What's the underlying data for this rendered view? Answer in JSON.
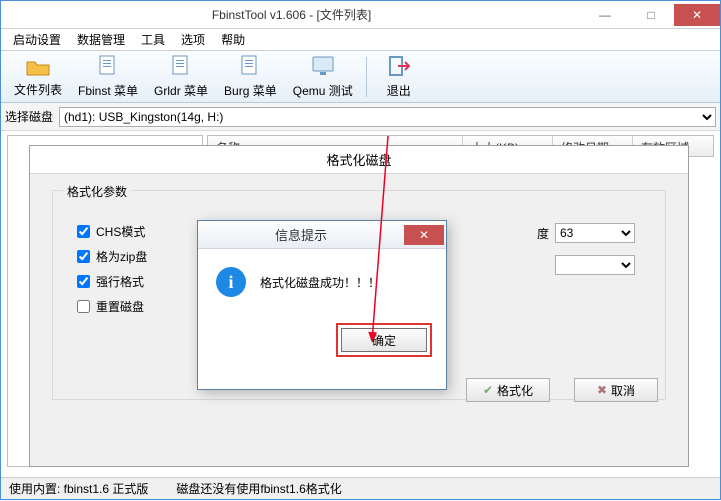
{
  "window": {
    "title": "FbinstTool v1.606 - [文件列表]"
  },
  "menu": {
    "items": [
      "启动设置",
      "数据管理",
      "工具",
      "选项",
      "帮助"
    ]
  },
  "toolbar": {
    "items": [
      "文件列表",
      "Fbinst 菜单",
      "Grldr 菜单",
      "Burg 菜单",
      "Qemu 测试",
      "退出"
    ]
  },
  "diskrow": {
    "label": "选择磁盘",
    "value": "(hd1): USB_Kingston(14g, H:)"
  },
  "table": {
    "cols": [
      "名称",
      "大小(KB)",
      "修改日期",
      "存放区域"
    ]
  },
  "format_dialog": {
    "title": "格式化磁盘",
    "group": "格式化参数",
    "chk1": "CHS模式",
    "chk2": "格为zip盘",
    "chk3": "强行格式",
    "chk4": "重置磁盘",
    "speed_label": "度",
    "speed_value": "63",
    "btn_format": "格式化",
    "btn_cancel": "取消"
  },
  "msg_dialog": {
    "title": "信息提示",
    "text": "格式化磁盘成功！！！",
    "ok": "确定"
  },
  "status": {
    "left": "使用内置: fbinst1.6 正式版",
    "right": "磁盘还没有使用fbinst1.6格式化"
  }
}
